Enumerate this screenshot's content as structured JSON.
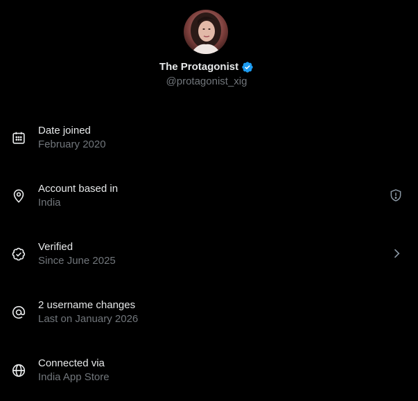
{
  "profile": {
    "display_name": "The Protagonist",
    "handle": "@protagonist_xig",
    "verified_badge_icon": "verified-badge-icon",
    "avatar": "avatar"
  },
  "details": [
    {
      "icon": "calendar-icon",
      "title": "Date joined",
      "subtitle": "February 2020"
    },
    {
      "icon": "location-pin-icon",
      "title": "Account based in",
      "subtitle": "India",
      "trailing_icon": "shield-alert-icon"
    },
    {
      "icon": "verified-check-icon",
      "title": "Verified",
      "subtitle": "Since June 2025",
      "trailing_icon": "chevron-right-icon"
    },
    {
      "icon": "at-sign-icon",
      "title": "2 username changes",
      "subtitle": "Last on January 2026"
    },
    {
      "icon": "globe-icon",
      "title": "Connected via",
      "subtitle": "India App Store"
    }
  ],
  "colors": {
    "background": "#000000",
    "primary_text": "#e7e9ea",
    "secondary_text": "#71767b",
    "verified_blue": "#1d9bf0"
  }
}
